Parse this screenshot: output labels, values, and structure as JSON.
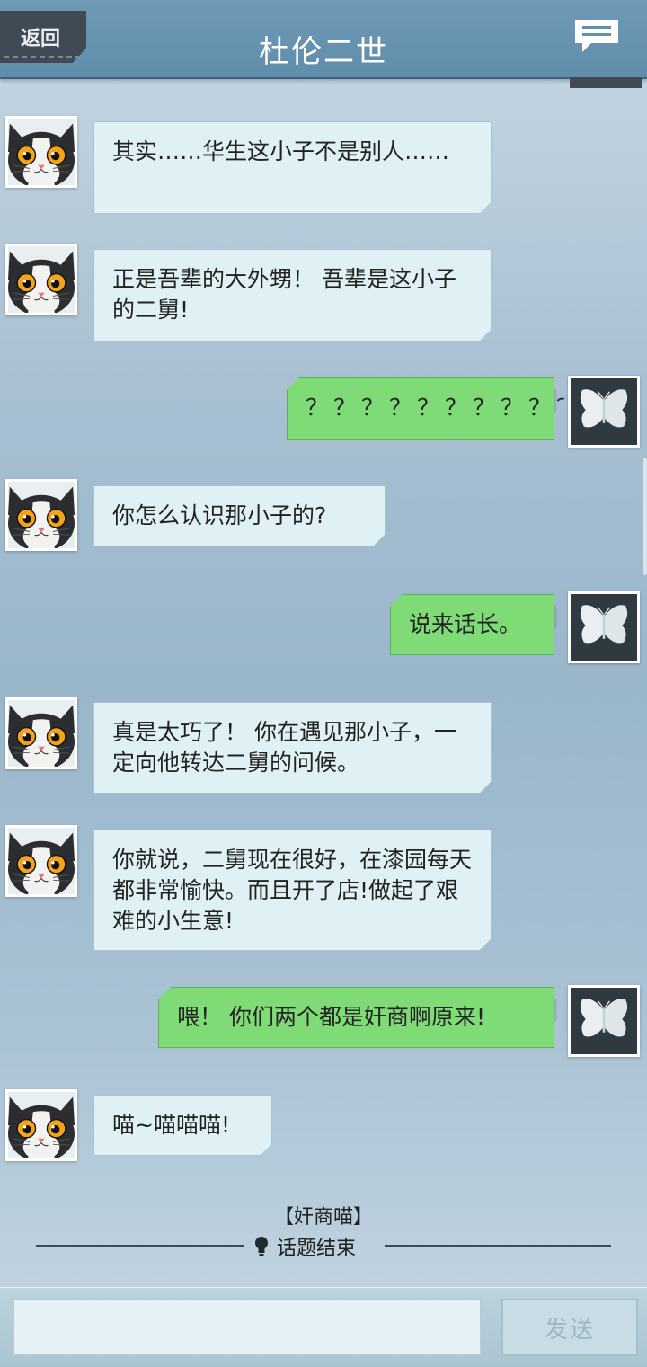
{
  "header": {
    "back_label": "返回",
    "title": "杜伦二世",
    "chat_icon": "chat-bubble-icon"
  },
  "messages": [
    {
      "side": "left",
      "avatar": "cat-avatar",
      "text": "其实……华生这小子不是别人……"
    },
    {
      "side": "left",
      "avatar": "cat-avatar",
      "text": "正是吾辈的大外甥！ 吾辈是这小子的二舅!"
    },
    {
      "side": "right",
      "avatar": "butterfly-avatar",
      "text": "？？？？？？？？？？"
    },
    {
      "side": "left",
      "avatar": "cat-avatar",
      "text": "你怎么认识那小子的?"
    },
    {
      "side": "right",
      "avatar": "butterfly-avatar",
      "text": "说来话长。"
    },
    {
      "side": "left",
      "avatar": "cat-avatar",
      "text": "真是太巧了！ 你在遇见那小子，一定向他转达二舅的问候。"
    },
    {
      "side": "left",
      "avatar": "cat-avatar",
      "text": "你就说，二舅现在很好，在漆园每天都非常愉快。而且开了店!做起了艰难的小生意!"
    },
    {
      "side": "right",
      "avatar": "butterfly-avatar",
      "text": "喂！ 你们两个都是奸商啊原来!"
    },
    {
      "side": "left",
      "avatar": "cat-avatar",
      "text": "喵~喵喵喵!"
    }
  ],
  "topic": {
    "name": "【奸商喵】",
    "end_label": "话题结束",
    "icon": "lightbulb-icon"
  },
  "input": {
    "placeholder": "",
    "send_label": "发送"
  },
  "colors": {
    "header": "#6390ad",
    "left_bubble": "#dff1f5",
    "right_bubble": "#7fdb75"
  }
}
